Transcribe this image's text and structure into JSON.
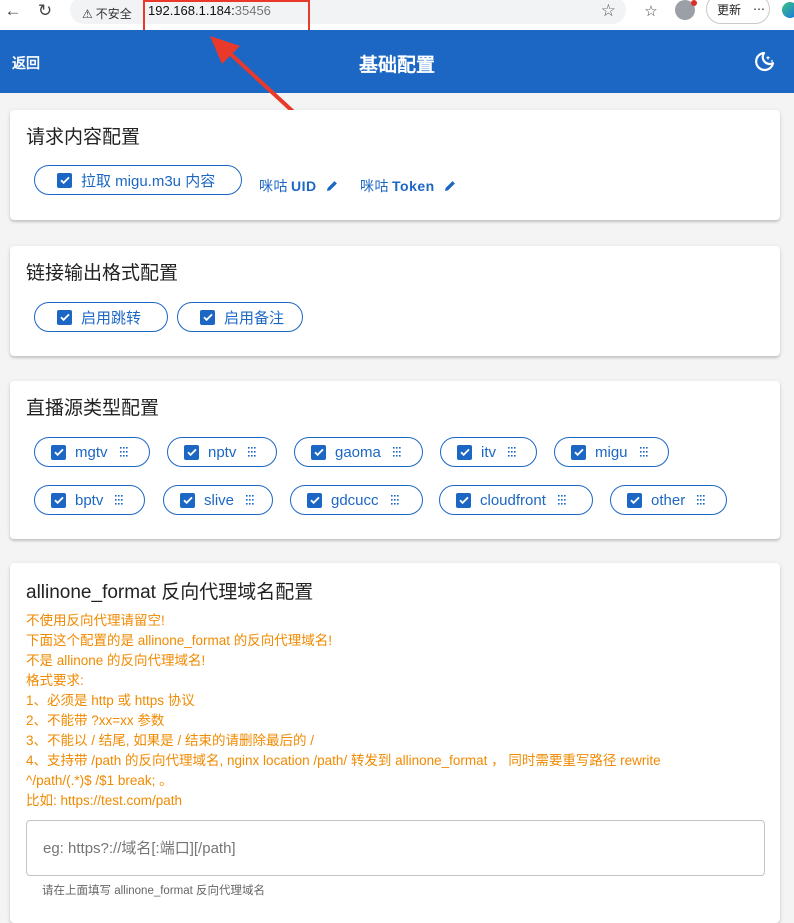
{
  "browser": {
    "security_label": "不安全",
    "url_host": "192.168.1.184:",
    "url_port": "35456",
    "update_label": "更新"
  },
  "appbar": {
    "back_label": "返回",
    "title": "基础配置"
  },
  "request_card": {
    "title": "请求内容配置",
    "pull_label": "拉取 migu.m3u 内容",
    "uid_cn": "咪咕",
    "uid_label": "UID",
    "token_cn": "咪咕",
    "token_label": "Token"
  },
  "output_card": {
    "title": "链接输出格式配置",
    "redirect_label": "启用跳转",
    "remark_label": "启用备注"
  },
  "source_card": {
    "title": "直播源类型配置",
    "types": [
      "mgtv",
      "nptv",
      "gaoma",
      "itv",
      "migu",
      "bptv",
      "slive",
      "gdcucc",
      "cloudfront",
      "other"
    ]
  },
  "proxy_card": {
    "title": "allinone_format 反向代理域名配置",
    "notes": [
      "不使用反向代理请留空!",
      "下面这个配置的是 allinone_format 的反向代理域名!",
      "不是 allinone 的反向代理域名!",
      "格式要求:",
      "1、必须是 http 或 https 协议",
      "2、不能带 ?xx=xx 参数",
      "3、不能以 / 结尾, 如果是 / 结束的请删除最后的 /",
      "4、支持带 /path 的反向代理域名, nginx location /path/ 转发到 allinone_format ， 同时需要重写路径 rewrite",
      "^/path/(.*)$ /$1 break; 。",
      "比如: https://test.com/path"
    ],
    "input_value": "",
    "input_placeholder": "eg: https?://域名[:端口][/path]",
    "hint": "请在上面填写 allinone_format 反向代理域名"
  },
  "colors": {
    "primary": "#1c67c4",
    "note": "#f08a00",
    "annotation": "#e8392b"
  }
}
